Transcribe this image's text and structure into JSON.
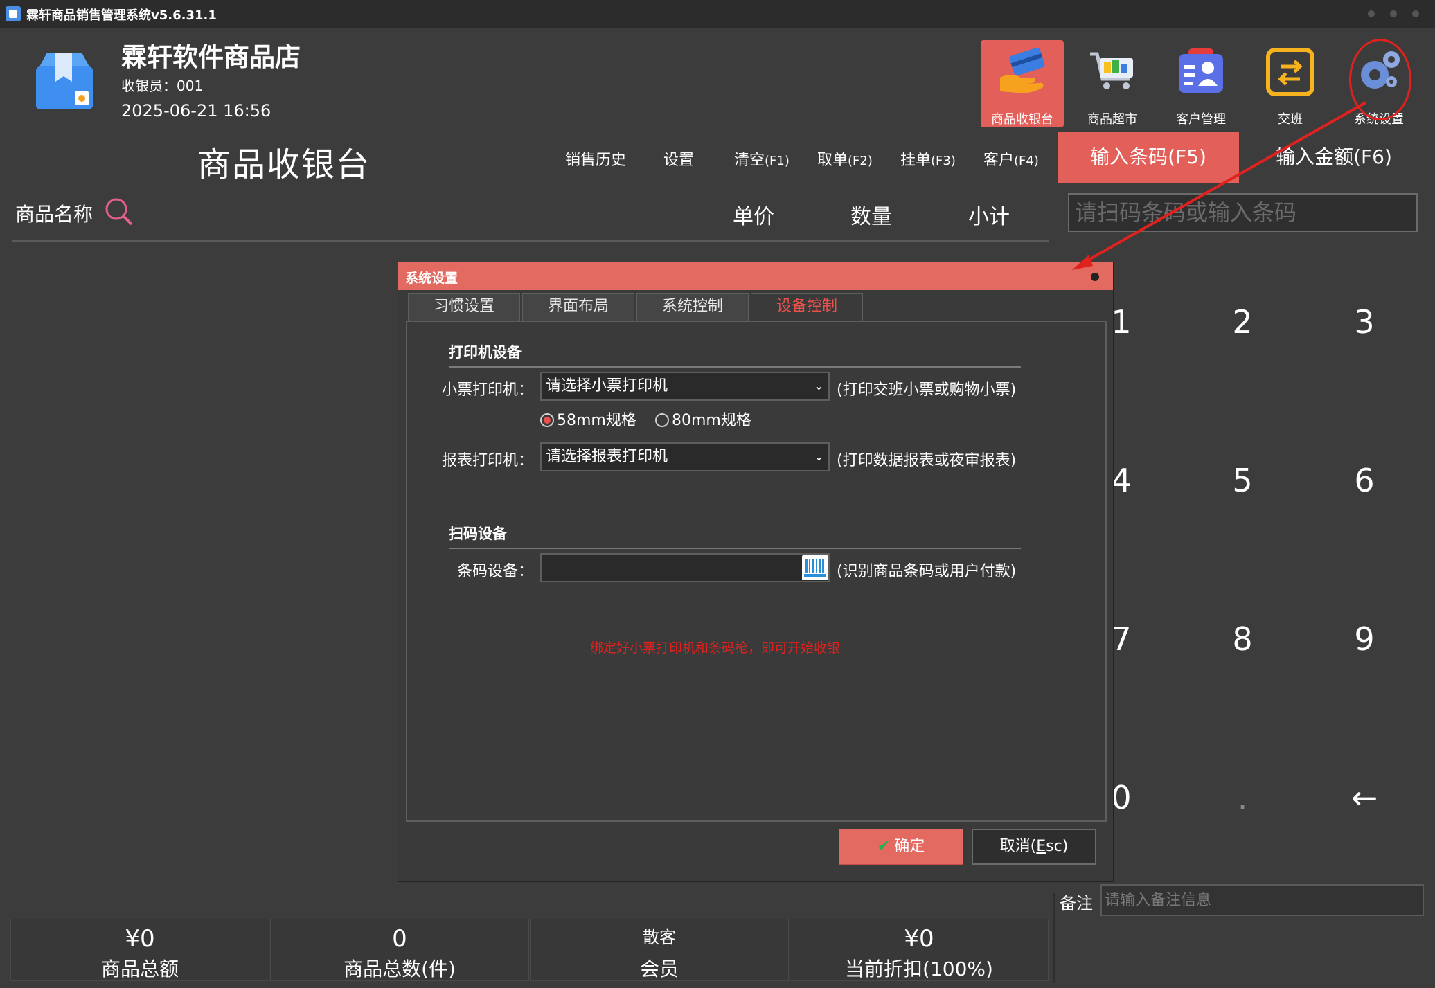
{
  "window": {
    "title": "霖轩商品销售管理系统v5.6.31.1"
  },
  "store": {
    "name": "霖轩软件商品店",
    "cashier": "收银员：001",
    "datetime": "2025-06-21 16:56"
  },
  "nav": [
    {
      "label": "商品收银台",
      "icon": "card-hand-icon",
      "active": true
    },
    {
      "label": "商品超市",
      "icon": "shopping-cart-icon",
      "active": false
    },
    {
      "label": "客户管理",
      "icon": "customer-card-icon",
      "active": false
    },
    {
      "label": "交班",
      "icon": "shift-exchange-icon",
      "active": false
    },
    {
      "label": "系统设置",
      "icon": "gears-icon",
      "active": false
    }
  ],
  "page_title": "商品收银台",
  "toolbar": {
    "sales_history": "销售历史",
    "settings": "设置",
    "clear": "清空",
    "clear_key": "(F1)",
    "retrieve": "取单",
    "retrieve_key": "(F2)",
    "hold": "挂单",
    "hold_key": "(F3)",
    "customer": "客户",
    "customer_key": "(F4)"
  },
  "input_tabs": {
    "barcode": "输入条码(F5)",
    "amount": "输入金额(F6)"
  },
  "barcode_placeholder": "请扫码条码或输入条码",
  "columns": {
    "name": "商品名称",
    "price": "单价",
    "qty": "数量",
    "subtotal": "小计"
  },
  "keypad": [
    "1",
    "2",
    "3",
    "4",
    "5",
    "6",
    "7",
    "8",
    "9",
    "0",
    ".",
    "←"
  ],
  "remark": {
    "label": "备注",
    "placeholder": "请输入备注信息"
  },
  "summary": {
    "total_amount": {
      "value": "¥0",
      "label": "商品总额"
    },
    "total_count": {
      "value": "0",
      "label": "商品总数(件)"
    },
    "member": {
      "value": "散客",
      "label": "会员"
    },
    "discount": {
      "value": "¥0",
      "label": "当前折扣(100%)"
    }
  },
  "dialog": {
    "title": "系统设置",
    "tabs": [
      "习惯设置",
      "界面布局",
      "系统控制",
      "设备控制"
    ],
    "active_tab": "设备控制",
    "printer_section": "打印机设备",
    "receipt_printer_label": "小票打印机：",
    "receipt_printer_value": "请选择小票打印机",
    "receipt_printer_note": "(打印交班小票或购物小票)",
    "size_58": "58mm规格",
    "size_80": "80mm规格",
    "size_selected": "58mm规格",
    "report_printer_label": "报表打印机：",
    "report_printer_value": "请选择报表打印机",
    "report_printer_note": "(打印数据报表或夜审报表)",
    "scan_section": "扫码设备",
    "barcode_device_label": "条码设备：",
    "barcode_device_value": "",
    "barcode_device_note": "(识别商品条码或用户付款)",
    "hint": "绑定好小票打印机和条码枪，即可开始收银",
    "ok": "确定",
    "cancel_prefix": "取消(",
    "cancel_key": "E",
    "cancel_suffix": "sc)"
  },
  "colors": {
    "accent": "#e25f5a",
    "background": "#3c3c3c",
    "annotation": "#e0221f"
  }
}
